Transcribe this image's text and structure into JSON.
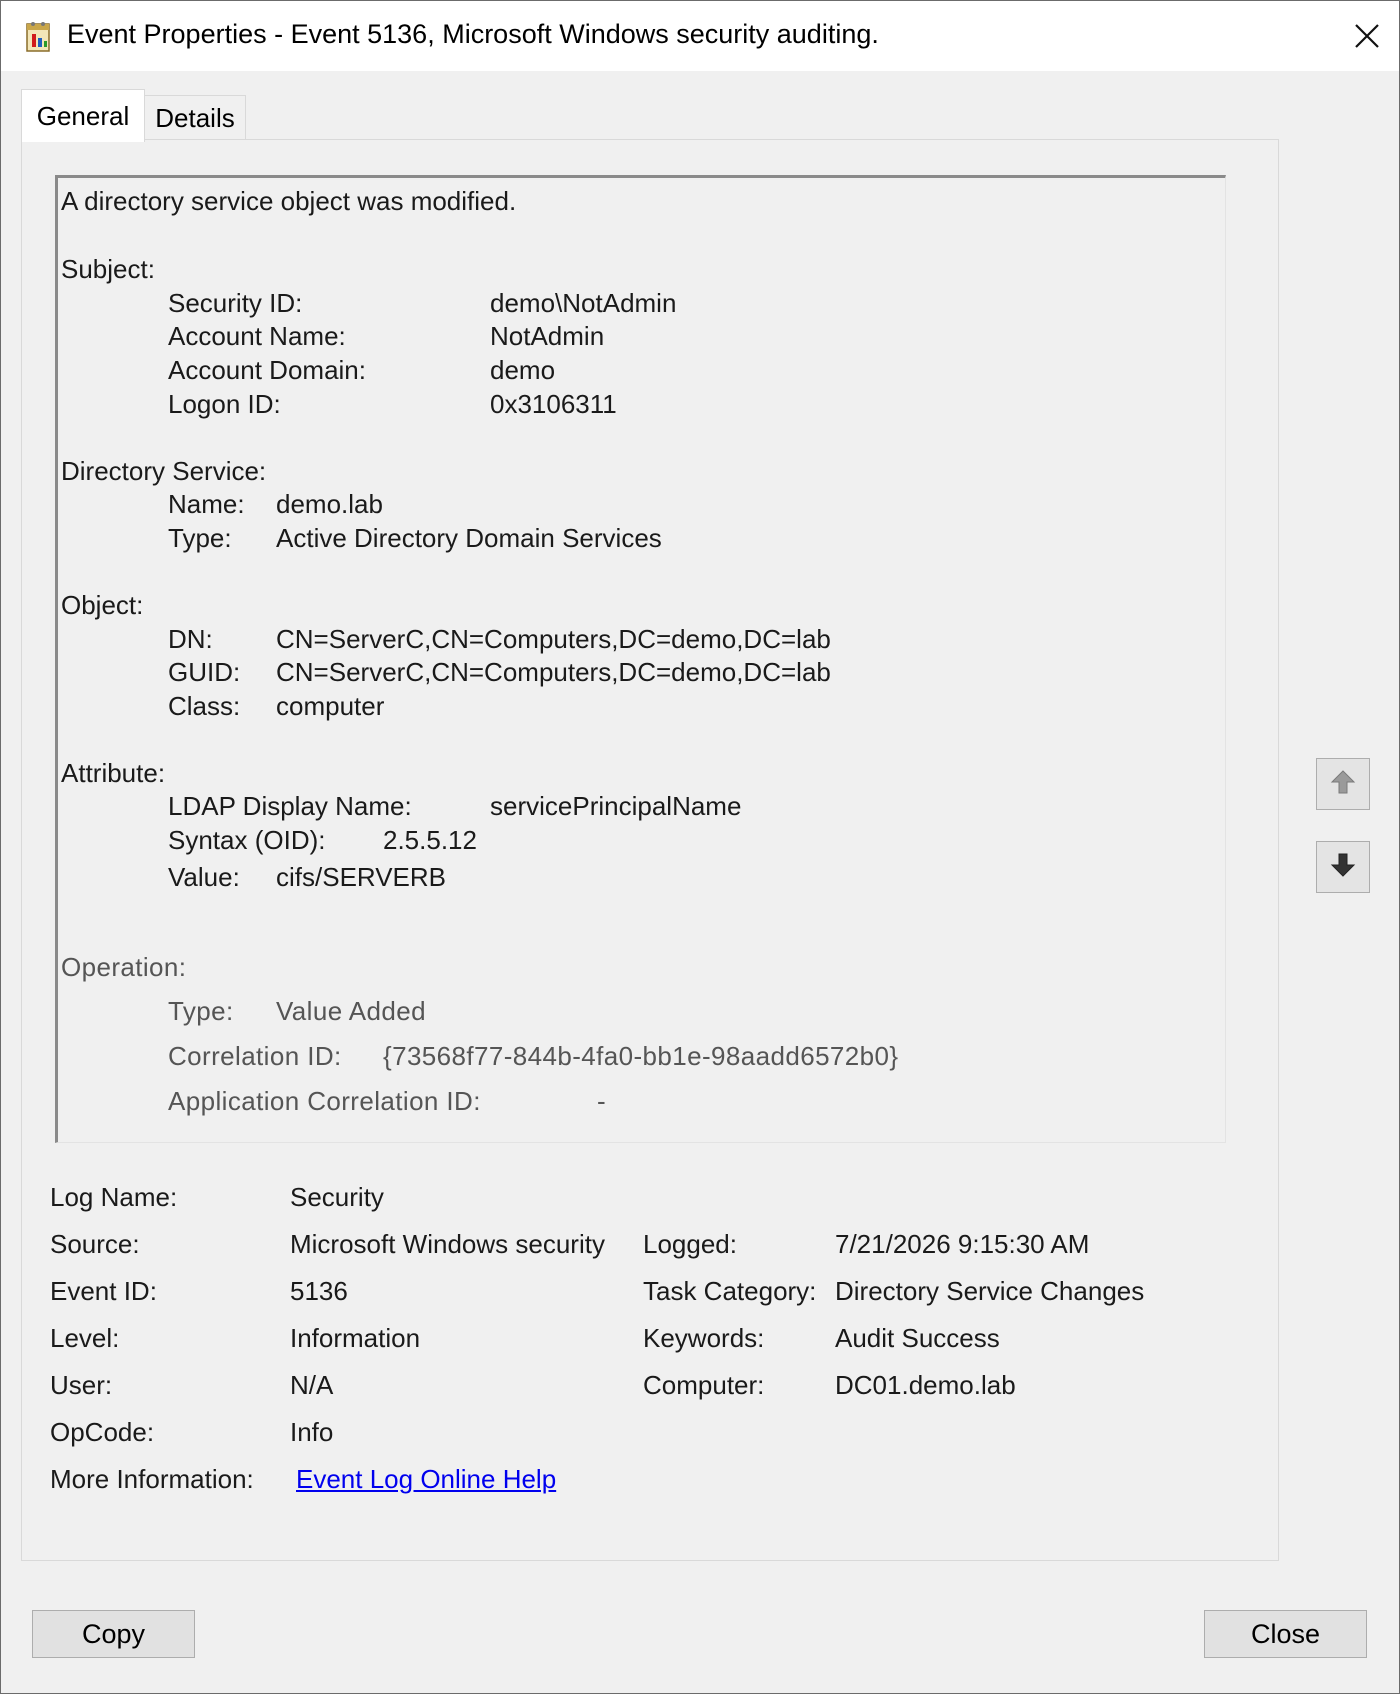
{
  "window": {
    "title": "Event Properties - Event 5136, Microsoft Windows security auditing."
  },
  "tabs": [
    {
      "label": "General",
      "selected": true
    },
    {
      "label": "Details",
      "selected": false
    }
  ],
  "description": {
    "headline": "A directory service object was modified.",
    "subject": {
      "heading": "Subject:",
      "security_id_label": "Security ID:",
      "security_id": "demo\\NotAdmin",
      "account_name_label": "Account Name:",
      "account_name": "NotAdmin",
      "account_domain_label": "Account Domain:",
      "account_domain": "demo",
      "logon_id_label": "Logon ID:",
      "logon_id": "0x3106311"
    },
    "directory_service": {
      "heading": "Directory Service:",
      "name_label": "Name:",
      "name": "demo.lab",
      "type_label": "Type:",
      "type": "Active Directory Domain Services"
    },
    "object": {
      "heading": "Object:",
      "dn_label": "DN:",
      "dn": "CN=ServerC,CN=Computers,DC=demo,DC=lab",
      "guid_label": "GUID:",
      "guid": "CN=ServerC,CN=Computers,DC=demo,DC=lab",
      "class_label": "Class:",
      "class": "computer"
    },
    "attribute": {
      "heading": "Attribute:",
      "ldap_label": "LDAP Display Name:",
      "ldap": "servicePrincipalName",
      "syntax_label": "Syntax (OID):",
      "syntax": "2.5.5.12",
      "value_label": "Value:",
      "value": "cifs/SERVERB"
    },
    "operation": {
      "heading": "Operation:",
      "type_label": "Type:",
      "type": "Value Added",
      "correlation_label": "Correlation ID:",
      "correlation": "{73568f77-844b-4fa0-bb1e-98aadd6572b0}",
      "app_correlation_label": "Application Correlation ID:",
      "app_correlation": "-"
    }
  },
  "details": {
    "log_name_label": "Log Name:",
    "log_name": "Security",
    "source_label": "Source:",
    "source": "Microsoft Windows security",
    "logged_label": "Logged:",
    "logged": "7/21/2026 9:15:30 AM",
    "event_id_label": "Event ID:",
    "event_id": "5136",
    "task_category_label": "Task Category:",
    "task_category": "Directory Service Changes",
    "level_label": "Level:",
    "level": "Information",
    "keywords_label": "Keywords:",
    "keywords": "Audit Success",
    "user_label": "User:",
    "user": "N/A",
    "computer_label": "Computer:",
    "computer": "DC01.demo.lab",
    "opcode_label": "OpCode:",
    "opcode": "Info",
    "more_info_label": "More Information:",
    "more_info_link": "Event Log Online Help"
  },
  "buttons": {
    "copy": "Copy",
    "close": "Close"
  },
  "icons": {
    "title": "event-log-icon",
    "close": "close-icon",
    "up": "arrow-up-icon",
    "down": "arrow-down-icon"
  }
}
